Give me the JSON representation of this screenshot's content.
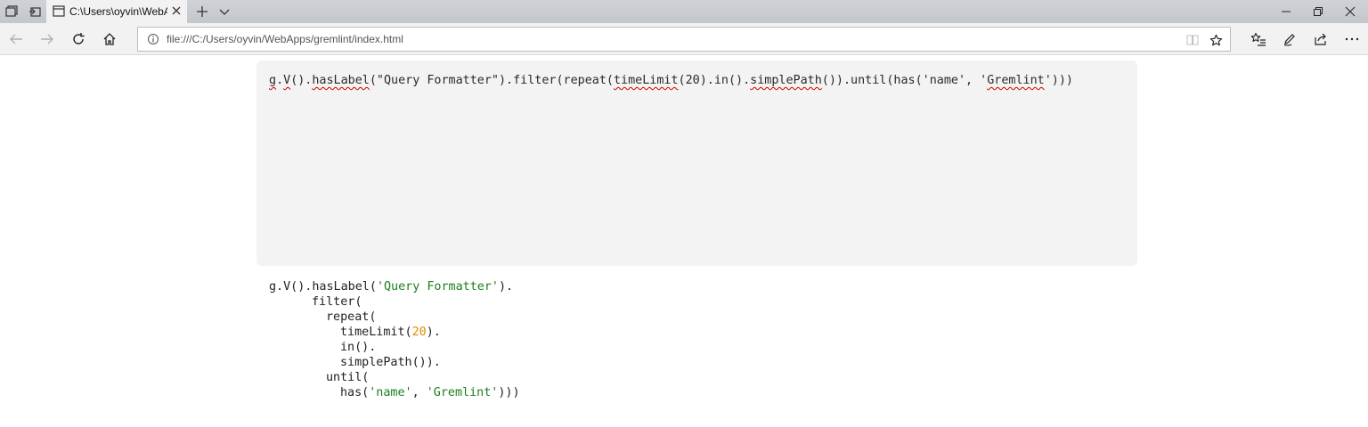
{
  "tab": {
    "title": "C:\\Users\\oyvin\\WebApps"
  },
  "address": {
    "url": "file:///C:/Users/oyvin/WebApps/gremlint/index.html"
  },
  "editor": {
    "query": "g.V().hasLabel(\"Query Formatter\").filter(repeat(timeLimit(20).in().simplePath()).until(has('name', 'Gremlint')))"
  },
  "formatted": {
    "l1a": "g.V().hasLabel(",
    "l1s": "'Query Formatter'",
    "l1b": ").",
    "l2": "filter(",
    "l3": "repeat(",
    "l4a": "timeLimit(",
    "l4n": "20",
    "l4b": ").",
    "l5": "in().",
    "l6": "simplePath()).",
    "l7": "until(",
    "l8a": "has(",
    "l8s1": "'name'",
    "l8c": ", ",
    "l8s2": "'Gremlint'",
    "l8b": ")))"
  },
  "icons": {
    "set_aside": "tabs-aside-icon",
    "show_aside": "tabs-restore-icon",
    "tab_page": "page-icon",
    "close": "close-icon",
    "new_tab": "plus-icon",
    "tab_list": "chevron-down-icon",
    "back": "back-arrow-icon",
    "forward": "forward-arrow-icon",
    "refresh": "refresh-icon",
    "home": "home-icon",
    "info": "info-icon",
    "reading_view": "book-icon",
    "favorite": "star-icon",
    "favorites_hub": "favorites-list-icon",
    "notes": "pen-icon",
    "share": "share-icon",
    "more": "more-icon"
  }
}
